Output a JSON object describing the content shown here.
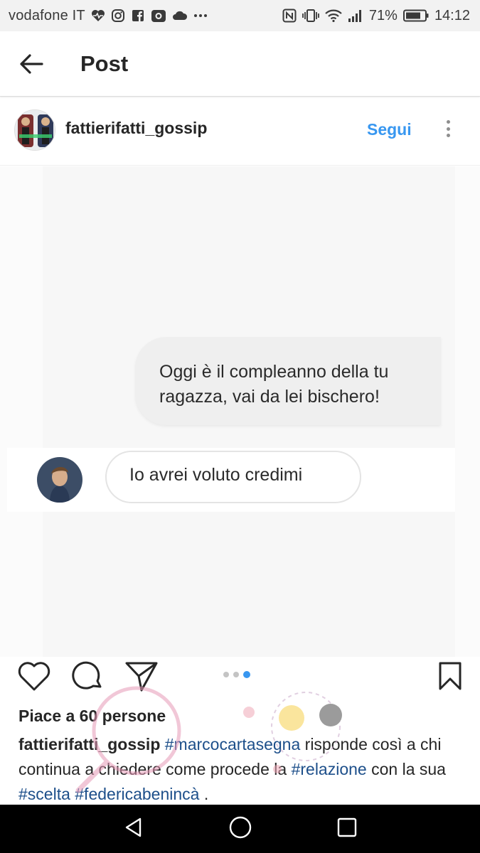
{
  "status_bar": {
    "carrier": "vodafone IT",
    "left_icons": [
      "heart-monitor-icon",
      "instagram-icon",
      "facebook-icon",
      "camera-app-icon",
      "cloud-icon",
      "more-notifications-icon"
    ],
    "right_icons": [
      "nfc-icon",
      "vibrate-icon",
      "wifi-icon",
      "signal-icon",
      "battery-icon"
    ],
    "battery": "71%",
    "time": "14:12"
  },
  "app_bar": {
    "title": "Post",
    "back_icon": "arrow-left-icon"
  },
  "post": {
    "username": "fattierifatti_gossip",
    "follow_label": "Segui",
    "more_icon": "more-vertical-icon",
    "media": {
      "sent_message": "Oggi è il compleanno della tu ragazza, vai da lei bischero!",
      "reply_message": "Io avrei voluto credimi",
      "carousel_count": 3,
      "carousel_active_index": 2
    },
    "actions": {
      "like_icon": "heart-icon",
      "comment_icon": "comment-icon",
      "share_icon": "send-icon",
      "save_icon": "bookmark-icon"
    },
    "likes": "Piace a 60 persone",
    "caption": {
      "username": "fattierifatti_gossip",
      "tag1": "#marcocartasegna",
      "text1": " risponde così a chi continua a chiedere come procede la ",
      "tag2": "#relazione",
      "text2": " con la sua ",
      "tag3": "#scelta",
      "text3": " ",
      "tag4": "#federicabenincà",
      "text4": " ."
    }
  },
  "colors": {
    "accent": "#3897f0",
    "hashtag": "#1d4f8a",
    "text": "#262626",
    "nav_bar": "#000000"
  },
  "nav_bar": {
    "icons": [
      "back-triangle-icon",
      "home-circle-icon",
      "recents-square-icon"
    ]
  }
}
